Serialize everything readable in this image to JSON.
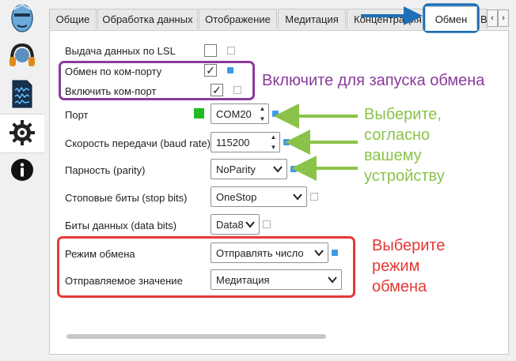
{
  "tabs": [
    {
      "label": "Общие"
    },
    {
      "label": "Обработка данных"
    },
    {
      "label": "Отображение"
    },
    {
      "label": "Медитация"
    },
    {
      "label": "Концентрация"
    },
    {
      "label": "Обмен"
    },
    {
      "label": "В"
    }
  ],
  "tab_scroll": {
    "left": "‹",
    "right": "›"
  },
  "sidebar": {
    "items": [
      {
        "icon": "face-icon"
      },
      {
        "icon": "headphones-icon"
      },
      {
        "icon": "document-icon"
      },
      {
        "icon": "gear-icon",
        "active": true
      },
      {
        "icon": "info-icon"
      }
    ]
  },
  "form": {
    "lsl_label": "Выдача данных по LSL",
    "lsl_checked": false,
    "com_exchange_label": "Обмен по ком-порту",
    "com_exchange_checked": true,
    "enable_port_label": "Включить ком-порт",
    "enable_port_checked": true,
    "port_label": "Порт",
    "port_value": "COM20",
    "port_status_color": "#22bb22",
    "baud_label": "Скорость передачи (baud rate)",
    "baud_value": "115200",
    "parity_label": "Парность (parity)",
    "parity_value": "NoParity",
    "stopbits_label": "Стоповые биты (stop bits)",
    "stopbits_value": "OneStop",
    "databits_label": "Биты данных (data bits)",
    "databits_value": "Data8",
    "mode_label": "Режим обмена",
    "mode_value": "Отправлять число",
    "sentvalue_label": "Отправляемое значение",
    "sentvalue_value": "Медитация"
  },
  "annotations": {
    "enable_text": "Включите для запуска обмена",
    "choose_device_lines": [
      "Выберите,",
      "согласно",
      "вашему",
      "устройству"
    ],
    "choose_mode_lines": [
      "Выберите",
      "режим",
      "обмена"
    ],
    "colors": {
      "purple": "#8b3a9c",
      "green": "#8bc34a",
      "red": "#e53935",
      "blue": "#1e6fb5"
    }
  }
}
